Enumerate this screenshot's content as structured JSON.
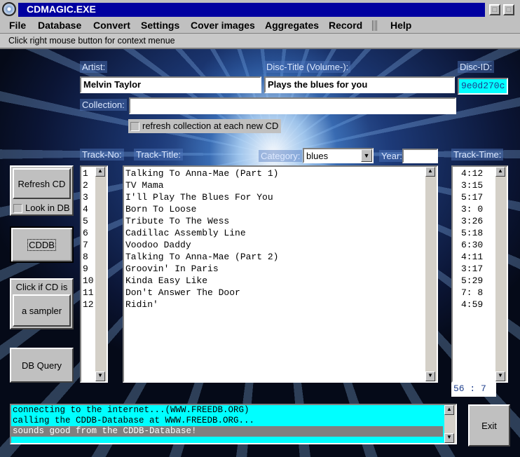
{
  "window": {
    "title": "CDMAGIC.EXE"
  },
  "menu": [
    "File",
    "Database",
    "Convert",
    "Settings",
    "Cover images",
    "Aggregates",
    "Record",
    "Help"
  ],
  "hint": "Click right mouse button for context menue",
  "form": {
    "artist_label": "Artist:",
    "artist_value": "Melvin Taylor",
    "disc_title_label": "Disc-Title (Volume-):",
    "disc_title_value": "Plays the blues for you",
    "disc_id_label": "Disc-ID:",
    "disc_id_value": "9e0d270c",
    "collection_label": "Collection:",
    "collection_value": "",
    "refresh_collection_label": "refresh collection at each new CD",
    "track_no_label": "Track-No:",
    "track_title_label": "Track-Title:",
    "category_label": "Category:",
    "category_value": "blues",
    "year_label": "Year:",
    "year_value": "",
    "track_time_label": "Track-Time:",
    "total_time": "56 : 7"
  },
  "tracks": [
    {
      "no": "1",
      "title": "Talking To Anna-Mae (Part 1)",
      "time": "4:12"
    },
    {
      "no": "2",
      "title": "TV Mama",
      "time": "3:15"
    },
    {
      "no": "3",
      "title": "I'll Play The Blues For You",
      "time": "5:17"
    },
    {
      "no": "4",
      "title": "Born To Loose",
      "time": "3: 0"
    },
    {
      "no": "5",
      "title": "Tribute To The Wess",
      "time": "3:26"
    },
    {
      "no": "6",
      "title": "Cadillac Assembly Line",
      "time": "5:18"
    },
    {
      "no": "7",
      "title": "Voodoo Daddy",
      "time": "6:30"
    },
    {
      "no": "8",
      "title": "Talking To Anna-Mae (Part 2)",
      "time": "4:11"
    },
    {
      "no": "9",
      "title": "Groovin' In Paris",
      "time": "3:17"
    },
    {
      "no": "10",
      "title": "Kinda Easy Like",
      "time": "5:29"
    },
    {
      "no": "11",
      "title": "Don't Answer The Door",
      "time": "7: 8"
    },
    {
      "no": "12",
      "title": "Ridin'",
      "time": "4:59"
    }
  ],
  "buttons": {
    "refresh_cd": "Refresh CD",
    "look_in_db": "Look in DB",
    "cddb": "CDDB",
    "sampler_caption": "Click if CD is",
    "sampler": "a sampler",
    "db_query": "DB Query",
    "exit": "Exit"
  },
  "log": [
    "connecting to the internet...(WWW.FREEDB.ORG)",
    "calling the CDDB-Database at WWW.FREEDB.ORG...",
    "sounds good from the CDDB-Database!"
  ],
  "colors": {
    "title_bar": "#0000a0",
    "disc_id_bg": "#00ffff",
    "log_bg": "#00ffff",
    "log_selected": "#808080"
  }
}
